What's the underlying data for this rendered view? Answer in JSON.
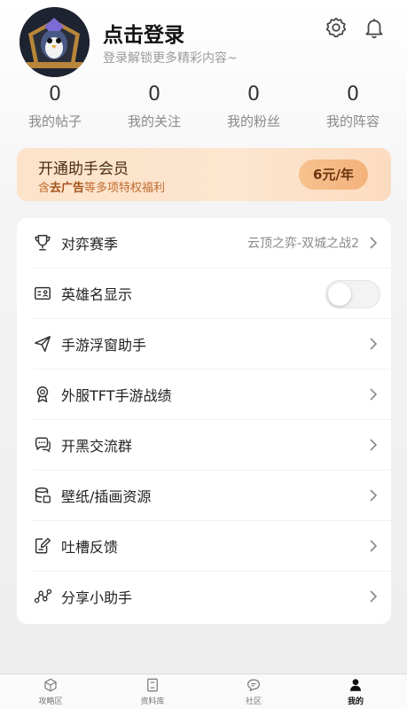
{
  "profile": {
    "login_title": "点击登录",
    "login_subtitle": "登录解锁更多精彩内容~",
    "avatar_icon": "penguin-avatar-icon"
  },
  "header_icons": [
    "gear-icon",
    "bell-icon"
  ],
  "stats": [
    {
      "count": "0",
      "label": "我的帖子"
    },
    {
      "count": "0",
      "label": "我的关注"
    },
    {
      "count": "0",
      "label": "我的粉丝"
    },
    {
      "count": "0",
      "label": "我的阵容"
    }
  ],
  "vip": {
    "title": "开通助手会员",
    "subtitle_highlight": "去广告",
    "subtitle_prefix": "含",
    "subtitle_suffix": "等多项特权福利",
    "price": "6元/年"
  },
  "menu": [
    {
      "label": "对弈赛季",
      "value": "云顶之弈-双城之战2",
      "icon": "trophy-icon"
    },
    {
      "label": "英雄名显示",
      "toggle": false,
      "icon": "id-card-icon"
    },
    {
      "label": "手游浮窗助手",
      "icon": "paper-plane-icon"
    },
    {
      "label": "外服TFT手游战绩",
      "icon": "medal-icon"
    },
    {
      "label": "开黑交流群",
      "icon": "chat-bubbles-icon"
    },
    {
      "label": "壁纸/插画资源",
      "icon": "database-icon"
    },
    {
      "label": "吐槽反馈",
      "icon": "edit-note-icon"
    },
    {
      "label": "分享小助手",
      "icon": "share-nodes-icon"
    }
  ],
  "tabs": [
    {
      "label": "攻略区",
      "icon": "cube-icon",
      "active": false
    },
    {
      "label": "资料库",
      "icon": "book-icon",
      "active": false
    },
    {
      "label": "社区",
      "icon": "chat-icon",
      "active": false
    },
    {
      "label": "我的",
      "icon": "person-icon",
      "active": true
    }
  ],
  "colors": {
    "vip_bg": "#fde3cb",
    "vip_accent": "#c06a2b",
    "price_button": "#f3b27c"
  }
}
